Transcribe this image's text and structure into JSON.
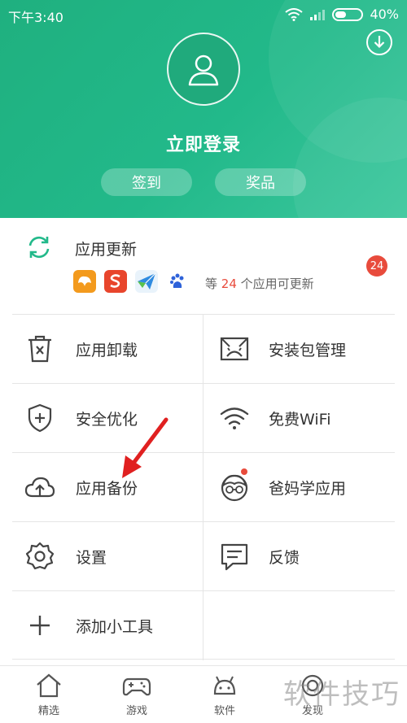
{
  "status_bar": {
    "time": "下午3:40",
    "battery": "40%"
  },
  "header": {
    "title": "立即登录",
    "sign_in_label": "签到",
    "prize_label": "奖品"
  },
  "update": {
    "title": "应用更新",
    "count_prefix": "等",
    "count": "24",
    "count_suffix": "个应用可更新",
    "badge": "24",
    "app_icons": [
      "uc-browser-icon",
      "sogou-input-icon",
      "paper-plane-icon",
      "baidu-icon"
    ]
  },
  "grid": {
    "uninstall": "应用卸载",
    "package_manage": "安装包管理",
    "security": "安全优化",
    "wifi": "免费WiFi",
    "backup": "应用备份",
    "parent": "爸妈学应用",
    "settings": "设置",
    "feedback": "反馈",
    "add_widget": "添加小工具"
  },
  "tabbar": {
    "featured": "精选",
    "games": "游戏",
    "software": "软件",
    "discover": "发现"
  },
  "watermark": "软件技巧",
  "colors": {
    "accent": "#22b98a",
    "badge_red": "#e84b3c",
    "icon_gray": "#444444"
  }
}
